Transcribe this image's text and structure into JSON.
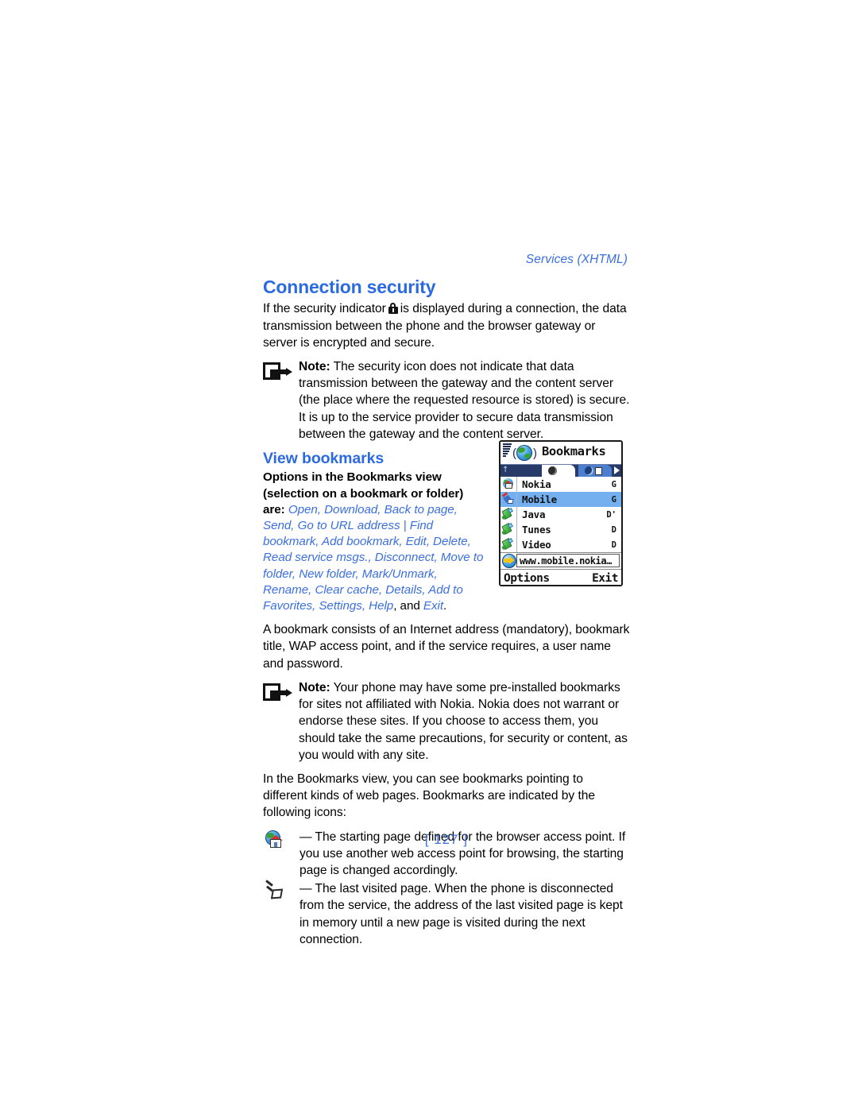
{
  "running_head": "Services (XHTML)",
  "page_number": "[ 127 ]",
  "sections": {
    "connection_security": {
      "heading": "Connection security",
      "intro_before_icon": "If the security indicator",
      "intro_after_icon": "is displayed during a connection, the data transmission between the phone and the browser gateway or server is encrypted and secure.",
      "note_label": "Note:",
      "note_text": " The security icon does not indicate that data transmission between the gateway and the content server (the place where the requested resource is stored) is secure. It is up to the service provider to secure data transmission between the gateway and the content server."
    },
    "view_bookmarks": {
      "heading": "View bookmarks",
      "options_lead": "Options in the Bookmarks view (selection on a bookmark or folder) are: ",
      "options_list": "Open, Download, Back to page, Send, Go to URL address | Find bookmark, Add bookmark, Edit, Delete, Read service msgs., Disconnect, Move to folder, New folder, Mark/Unmark, Rename, Clear cache, Details, Add to Favorites, Settings, Help",
      "options_tail_and": ", and ",
      "options_tail_exit": "Exit",
      "options_tail_period": ".",
      "bookmark_def": "A bookmark consists of an Internet address (mandatory), bookmark title, WAP access point, and if the service requires, a user name and password.",
      "note2_label": "Note:",
      "note2_text": " Your phone may have some pre-installed bookmarks for sites not affiliated with Nokia. Nokia does not warrant or endorse these sites. If you choose to access them, you should take the same precautions, for security or content, as you would with any site.",
      "icons_intro": "In the Bookmarks view, you can see bookmarks pointing to different kinds of web pages. Bookmarks are indicated by the following icons:",
      "icon_items": [
        {
          "icon": "globe-home-icon",
          "text": "— The starting page defined for the browser access point. If you use another web access point for browsing, the starting page is changed accordingly."
        },
        {
          "icon": "pointer-last-visited-icon",
          "text": "— The last visited page. When the phone is disconnected from the service, the address of the last visited page is kept in memory until a new page is visited during the next connection."
        }
      ]
    }
  },
  "phone_screenshot": {
    "title": "Bookmarks",
    "tabs": [
      {
        "name": "bookmarks-tab",
        "state": "active"
      },
      {
        "name": "pages-tab",
        "state": "inactive"
      }
    ],
    "list": [
      {
        "label": "Nokia",
        "flag": "G",
        "icon": "globe-home-icon",
        "selected": false
      },
      {
        "label": "Mobile",
        "flag": "G",
        "icon": "pointer-icon",
        "selected": true
      },
      {
        "label": "Java",
        "flag": "D'",
        "icon": "bookmark-tag-icon",
        "selected": false
      },
      {
        "label": "Tunes",
        "flag": "D",
        "icon": "bookmark-tag-icon",
        "selected": false
      },
      {
        "label": "Video",
        "flag": "D",
        "icon": "bookmark-tag-icon",
        "selected": false
      }
    ],
    "url": "www.mobile.nokia…",
    "softkey_left": "Options",
    "softkey_right": "Exit"
  },
  "colors": {
    "heading_blue": "#2b6ae0",
    "accent_blue": "#3b6fe0",
    "selection_blue": "#74b0ef",
    "tabbar_navy": "#283a68"
  }
}
